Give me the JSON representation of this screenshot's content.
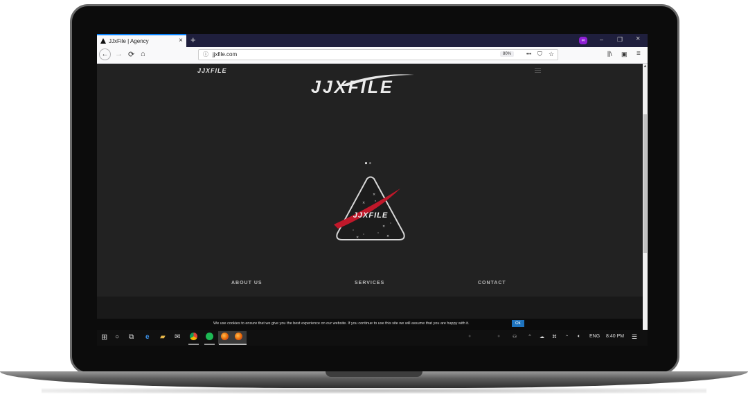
{
  "browser": {
    "tab_title": "JJxFile | Agency",
    "tab_close": "×",
    "new_tab": "+",
    "url": "jjxfile.com",
    "zoom": "80%",
    "page_actions": "•••",
    "window_minimize": "–",
    "window_maximize": "❐",
    "window_close": "×"
  },
  "site": {
    "small_logo": "JJXFILE",
    "brand": "JJXFILE",
    "badge_text": "JJXFILE",
    "nav": [
      "ABOUT US",
      "SERVICES",
      "CONTACT"
    ]
  },
  "cookie": {
    "message": "We use cookies to ensure that we give you the best experience on our website. If you continue to use this site we will assume that you are happy with it.",
    "ok_label": "Ok"
  },
  "taskbar": {
    "language": "ENG",
    "time": "8:40 PM"
  },
  "colors": {
    "page_bg": "#222222",
    "accent_red": "#c0182a",
    "tab_accent": "#0a84ff",
    "cookie_button": "#1e73be"
  }
}
